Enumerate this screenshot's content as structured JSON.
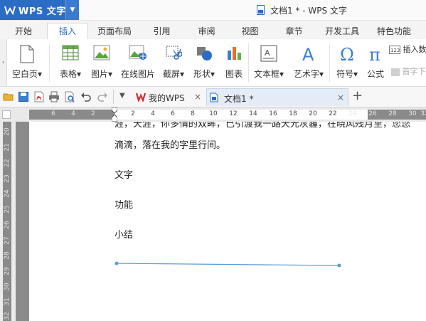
{
  "app": {
    "button_label": "WPS 文字",
    "window_title": "文档1 * - WPS 文字"
  },
  "menu": {
    "tabs": [
      "开始",
      "插入",
      "页面布局",
      "引用",
      "审阅",
      "视图",
      "章节",
      "开发工具",
      "特色功能"
    ],
    "active_index": 1
  },
  "ribbon": {
    "blank_page": "空白页",
    "table": "表格",
    "picture": "图片",
    "online_picture": "在线图片",
    "screenshot": "截屏",
    "shape": "形状",
    "chart": "图表",
    "textbox": "文本框",
    "wordart": "艺术字",
    "symbol": "符号",
    "formula": "公式",
    "insert_number": "插入数",
    "drop_cap": "首字下"
  },
  "doc_tabs": {
    "my_wps": "我的WPS",
    "doc1": "文档1 *"
  },
  "ruler": {
    "h_numbers": [
      "6",
      "4",
      "2",
      "2",
      "4",
      "6",
      "8",
      "10",
      "12",
      "14",
      "16",
      "18",
      "20",
      "22",
      "24",
      "26",
      "28",
      "30",
      "32"
    ],
    "v_numbers": [
      "20",
      "21",
      "22",
      "23",
      "24",
      "25",
      "26",
      "27",
      "28",
      "29",
      "30",
      "31",
      "32"
    ]
  },
  "document": {
    "clipped_line": "涯，天涯，你多情的双眸，已引渡我一路天光灰霾，在晓风残月里，您您",
    "line1": "滴滴，落在我的字里行间。",
    "para1": "文字",
    "para2": "功能",
    "para3": "小结"
  },
  "colors": {
    "accent": "#2b6cc5",
    "wps_red": "#d9262c",
    "drawn_line": "#5b9bd5"
  }
}
